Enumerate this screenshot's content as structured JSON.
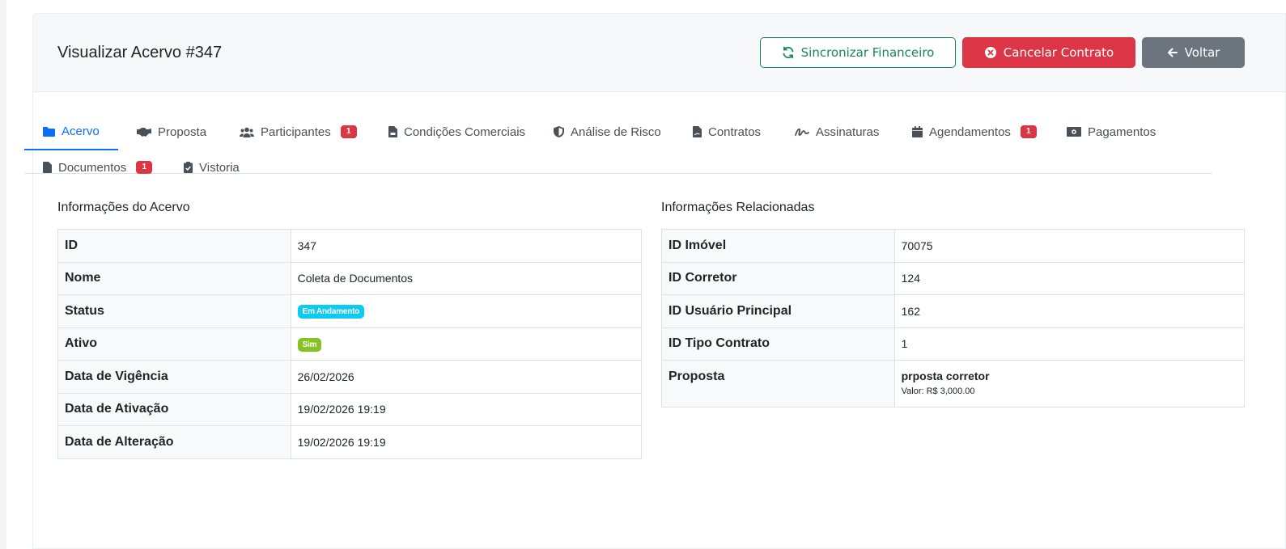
{
  "header": {
    "title": "Visualizar Acervo #347",
    "actions": {
      "sync": "Sincronizar Financeiro",
      "cancel": "Cancelar Contrato",
      "back": "Voltar"
    }
  },
  "tabs": [
    {
      "label": "Acervo",
      "icon": "folder-icon",
      "active": true
    },
    {
      "label": "Proposta",
      "icon": "handshake-icon"
    },
    {
      "label": "Participantes",
      "icon": "users-icon",
      "badge": "1"
    },
    {
      "label": "Condições Comerciais",
      "icon": "file-invoice-icon"
    },
    {
      "label": "Análise de Risco",
      "icon": "shield-icon"
    },
    {
      "label": "Contratos",
      "icon": "file-contract-icon"
    },
    {
      "label": "Assinaturas",
      "icon": "signature-icon"
    },
    {
      "label": "Agendamentos",
      "icon": "calendar-icon",
      "badge": "1"
    },
    {
      "label": "Pagamentos",
      "icon": "money-bill-icon"
    },
    {
      "label": "Documentos",
      "icon": "file-icon",
      "badge": "1"
    },
    {
      "label": "Vistoria",
      "icon": "clipboard-check-icon"
    }
  ],
  "acervo": {
    "section_title": "Informações do Acervo",
    "rows": [
      {
        "label": "ID",
        "value": "347"
      },
      {
        "label": "Nome",
        "value": "Coleta de Documentos"
      },
      {
        "label": "Status",
        "value": "Em Andamento"
      },
      {
        "label": "Ativo",
        "value": "Sim"
      },
      {
        "label": "Data de Vigência",
        "value": "26/02/2026"
      },
      {
        "label": "Data de Ativação",
        "value": "19/02/2026 19:19"
      },
      {
        "label": "Data de Alteração",
        "value": "19/02/2026 19:19"
      }
    ]
  },
  "related": {
    "section_title": "Informações Relacionadas",
    "rows": [
      {
        "label": "ID Imóvel",
        "value": "70075"
      },
      {
        "label": "ID Corretor",
        "value": "124"
      },
      {
        "label": "ID Usuário Principal",
        "value": "162"
      },
      {
        "label": "ID Tipo Contrato",
        "value": "1"
      },
      {
        "label": "Proposta",
        "value": "prposta corretor",
        "sub": "Valor: R$ 3,000.00"
      }
    ]
  },
  "colors": {
    "primary": "#0d6efd",
    "success": "#198754",
    "danger": "#dc3545",
    "secondary": "#6c757d",
    "info": "#0dcaf0",
    "active_green": "#84c225"
  }
}
